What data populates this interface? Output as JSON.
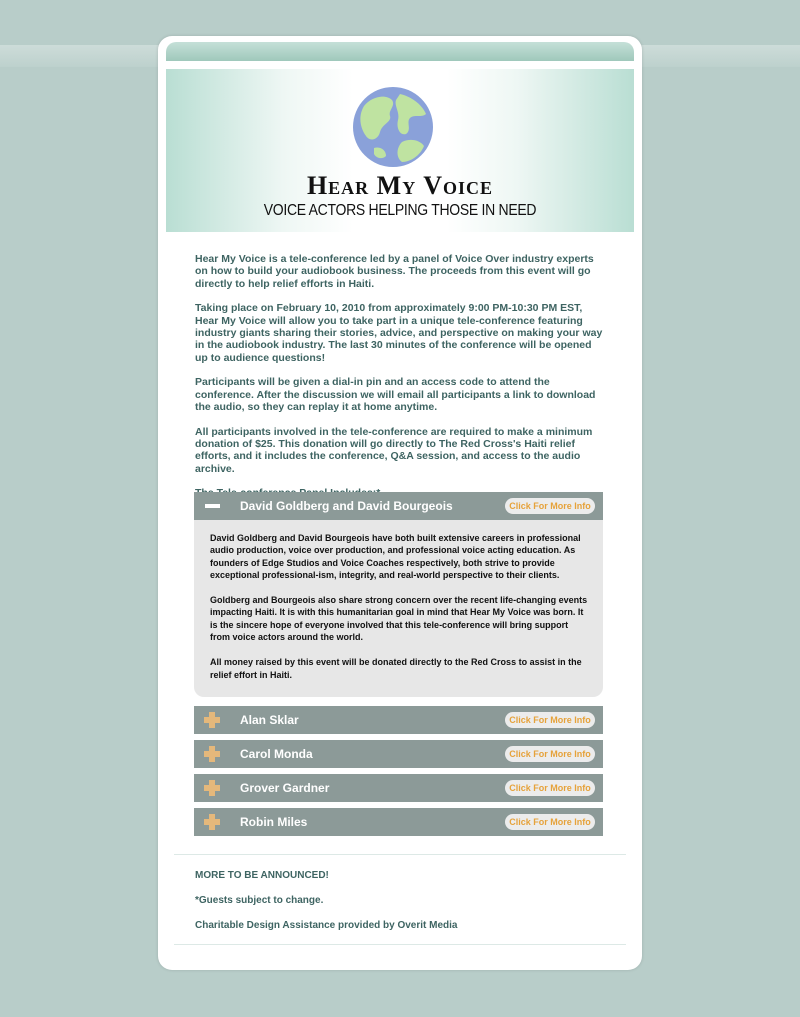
{
  "brand": {
    "title": "Hear My Voice",
    "subtitle": "VOICE ACTORS HELPING THOSE IN NEED",
    "logo_icon": "globe-icon"
  },
  "intro": [
    "Hear My Voice is a tele-conference led by a panel of Voice Over industry experts on how to build your audiobook business. The proceeds from this event will go directly to help relief efforts in Haiti.",
    "Taking place on February 10, 2010 from approximately 9:00 PM-10:30 PM EST, Hear My Voice will allow you to take part in a unique tele-conference featuring industry giants sharing their stories, advice, and perspective on making your way in the audiobook industry. The last 30 minutes of the conference will be opened up to audience questions!",
    "Participants will be given a dial-in pin and an access code to attend the conference.  After the discussion we will email all participants a link to download the audio, so they can replay it at home anytime.",
    "All participants involved in the tele-conference are required to make a minimum donation of $25.  This donation will go directly to The Red Cross's Haiti relief efforts, and it includes the conference, Q&A session, and access to the audio archive."
  ],
  "panel_label": "The Tele-conference Panel Includes:*",
  "more_info_label": "Click For More Info",
  "panel": [
    {
      "name": "David Goldberg and David Bourgeois",
      "expanded": true,
      "body": [
        "David Goldberg and David Bourgeois have both built extensive careers in professional audio production, voice over production, and professional voice acting education.  As founders of Edge Studios and Voice Coaches respectively, both strive to provide exceptional professional-ism, integrity, and real-world perspective to their clients.",
        "Goldberg and Bourgeois also share strong concern over the recent life-changing events impacting Haiti.  It is with this humanitarian goal in mind that Hear My Voice was born.  It is the sincere hope of everyone involved that this tele-conference will bring support from voice actors around the world.",
        "All money raised by this event will be donated directly to the Red Cross to assist in the relief effort in Haiti."
      ]
    },
    {
      "name": "Alan Sklar",
      "expanded": false
    },
    {
      "name": "Carol Monda",
      "expanded": false
    },
    {
      "name": "Grover Gardner",
      "expanded": false
    },
    {
      "name": "Robin Miles",
      "expanded": false
    }
  ],
  "footer": {
    "announce": "MORE TO BE ANNOUNCED!",
    "guests_note": "*Guests subject to change.",
    "credit": "Charitable Design Assistance provided by Overit Media"
  },
  "colors": {
    "page_bg": "#b8cdc9",
    "text_teal": "#3e6462",
    "accordion_header": "#8c9a98",
    "accent_orange": "#e6a23a",
    "plus_icon": "#e5b87b"
  }
}
